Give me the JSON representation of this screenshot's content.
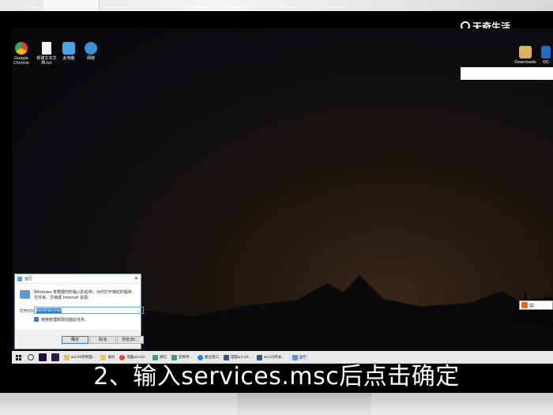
{
  "logo": {
    "text": "天奇生活"
  },
  "desktop_icons": [
    {
      "label": "Google Chrome",
      "icon": "chrome-icon"
    },
    {
      "label": "新建文本文档.txt",
      "icon": "text-file-icon"
    },
    {
      "label": "此电脑",
      "icon": "computer-icon"
    },
    {
      "label": "网络",
      "icon": "network-icon"
    }
  ],
  "right_icons": [
    {
      "label": "Downloads",
      "icon": "downloads-folder-icon"
    },
    {
      "label": "QQ",
      "icon": "qq-icon"
    }
  ],
  "run_dialog": {
    "title": "运行",
    "close": "✕",
    "description": "Windows 将根据你所输入的名称，为你打开相应的程序、文件夹、文档或 Internet 资源。",
    "open_label": "打开(O):",
    "input_value": "services.msc",
    "admin_note": "使用管理权限创建此任务。",
    "ok": "确定",
    "cancel": "取消",
    "browse": "浏览(B)..."
  },
  "ime": {
    "text": "中"
  },
  "taskbar": {
    "apps": [
      {
        "label": "win10控制面...",
        "color": "#f2c14e"
      },
      {
        "label": "素材",
        "color": "#f2c14e"
      },
      {
        "label": "电脑win10...",
        "color": "#e94335"
      },
      {
        "label": "微信",
        "color": "#2aae67"
      },
      {
        "label": "剪映专...",
        "color": "#2aae67"
      },
      {
        "label": "嘉豆窗口",
        "color": "#1e88e5"
      },
      {
        "label": "电脑win10...",
        "color": "#2b5797"
      },
      {
        "label": "win10开发...",
        "color": "#2b5797"
      },
      {
        "label": "运行",
        "color": "#5a9bd6"
      }
    ]
  },
  "subtitle": "2、输入services.msc后点击确定",
  "colors": {
    "taskbar": "#e9e9e9",
    "subtitle": "#ffffff",
    "selection": "#3378d4"
  }
}
